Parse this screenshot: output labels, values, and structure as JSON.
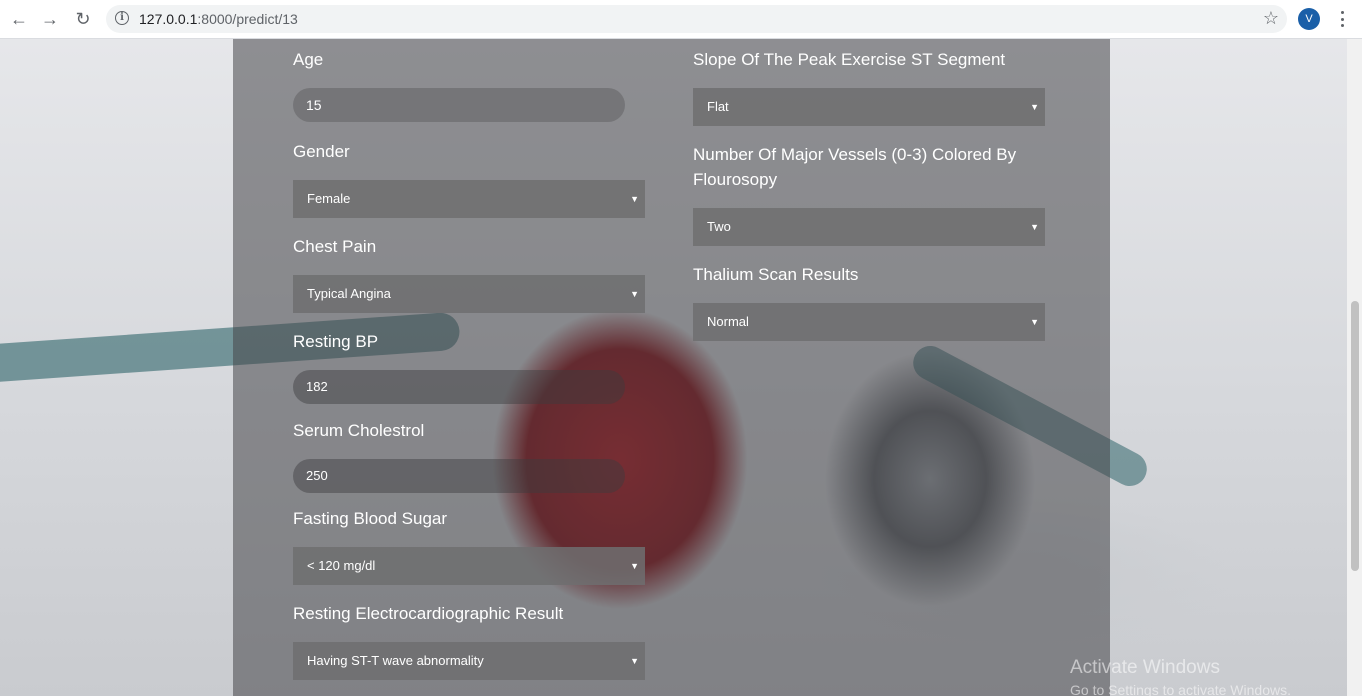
{
  "browser": {
    "url_host": "127.0.0.1",
    "url_path": ":8000/predict/13",
    "avatar_letter": "V"
  },
  "form_left": {
    "age": {
      "label": "Age",
      "value": "15"
    },
    "gender": {
      "label": "Gender",
      "value": "Female"
    },
    "chest_pain": {
      "label": "Chest Pain",
      "value": "Typical Angina"
    },
    "resting_bp": {
      "label": "Resting BP",
      "value": "182"
    },
    "serum_cholestrol": {
      "label": "Serum Cholestrol",
      "value": "250"
    },
    "fasting_blood_sugar": {
      "label": "Fasting Blood Sugar",
      "value": "< 120 mg/dl"
    },
    "resting_ecg": {
      "label": "Resting Electrocardiographic Result",
      "value": "Having ST-T wave abnormality"
    }
  },
  "form_right": {
    "slope": {
      "label": "Slope Of The Peak Exercise ST Segment",
      "value": "Flat"
    },
    "vessels": {
      "label": "Number Of Major Vessels (0-3) Colored By Flourosopy",
      "value": "Two"
    },
    "thalium": {
      "label": "Thalium Scan Results",
      "value": "Normal"
    }
  },
  "watermark": {
    "title": "Activate Windows",
    "subtitle": "Go to Settings to activate Windows."
  },
  "colors": {
    "panel_overlay": "#464648",
    "avatar_bg": "#1a5fa8"
  }
}
